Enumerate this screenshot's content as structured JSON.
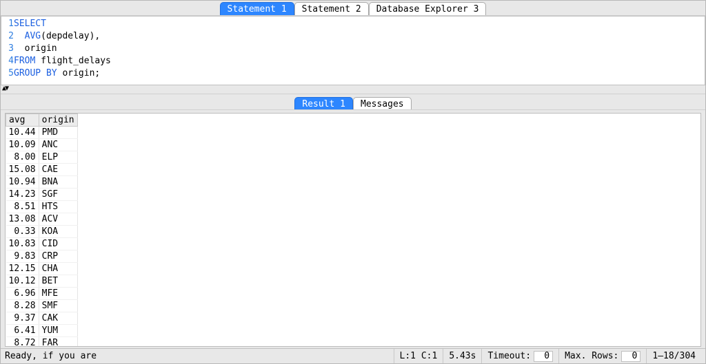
{
  "top_tabs": [
    {
      "label": "Statement 1",
      "active": true
    },
    {
      "label": "Statement 2",
      "active": false
    },
    {
      "label": "Database Explorer 3",
      "active": false
    }
  ],
  "editor": {
    "lines": [
      {
        "n": 1,
        "tokens": [
          {
            "t": "SELECT",
            "c": "kw"
          }
        ]
      },
      {
        "n": 2,
        "tokens": [
          {
            "t": "  ",
            "c": "plain"
          },
          {
            "t": "AVG",
            "c": "kw"
          },
          {
            "t": "(depdelay),",
            "c": "plain"
          }
        ]
      },
      {
        "n": 3,
        "tokens": [
          {
            "t": "  origin",
            "c": "plain"
          }
        ]
      },
      {
        "n": 4,
        "tokens": [
          {
            "t": "FROM",
            "c": "kw"
          },
          {
            "t": " flight_delays",
            "c": "plain"
          }
        ]
      },
      {
        "n": 5,
        "tokens": [
          {
            "t": "GROUP BY",
            "c": "kw"
          },
          {
            "t": " origin;",
            "c": "plain"
          }
        ]
      }
    ]
  },
  "mid_tabs": [
    {
      "label": "Result 1",
      "active": true
    },
    {
      "label": "Messages",
      "active": false
    }
  ],
  "result": {
    "columns": [
      "avg",
      "origin"
    ],
    "rows": [
      {
        "avg": "10.44",
        "origin": "PMD"
      },
      {
        "avg": "10.09",
        "origin": "ANC"
      },
      {
        "avg": "8.00",
        "origin": "ELP"
      },
      {
        "avg": "15.08",
        "origin": "CAE"
      },
      {
        "avg": "10.94",
        "origin": "BNA"
      },
      {
        "avg": "14.23",
        "origin": "SGF"
      },
      {
        "avg": "8.51",
        "origin": "HTS"
      },
      {
        "avg": "13.08",
        "origin": "ACV"
      },
      {
        "avg": "0.33",
        "origin": "KOA"
      },
      {
        "avg": "10.83",
        "origin": "CID"
      },
      {
        "avg": "9.83",
        "origin": "CRP"
      },
      {
        "avg": "12.15",
        "origin": "CHA"
      },
      {
        "avg": "10.12",
        "origin": "BET"
      },
      {
        "avg": "6.96",
        "origin": "MFE"
      },
      {
        "avg": "8.28",
        "origin": "SMF"
      },
      {
        "avg": "9.37",
        "origin": "CAK"
      },
      {
        "avg": "6.41",
        "origin": "YUM"
      },
      {
        "avg": "8.72",
        "origin": "FAR"
      }
    ]
  },
  "status": {
    "ready": "Ready, if you are",
    "cursor": "L:1 C:1",
    "elapsed": "5.43s",
    "timeout_label": "Timeout:",
    "timeout_value": "0",
    "maxrows_label": "Max. Rows:",
    "maxrows_value": "0",
    "range": "1–18/304"
  },
  "chart_data": {
    "type": "table",
    "title": "AVG(depdelay) by origin",
    "columns": [
      "avg",
      "origin"
    ],
    "rows": [
      [
        10.44,
        "PMD"
      ],
      [
        10.09,
        "ANC"
      ],
      [
        8.0,
        "ELP"
      ],
      [
        15.08,
        "CAE"
      ],
      [
        10.94,
        "BNA"
      ],
      [
        14.23,
        "SGF"
      ],
      [
        8.51,
        "HTS"
      ],
      [
        13.08,
        "ACV"
      ],
      [
        0.33,
        "KOA"
      ],
      [
        10.83,
        "CID"
      ],
      [
        9.83,
        "CRP"
      ],
      [
        12.15,
        "CHA"
      ],
      [
        10.12,
        "BET"
      ],
      [
        6.96,
        "MFE"
      ],
      [
        8.28,
        "SMF"
      ],
      [
        9.37,
        "CAK"
      ],
      [
        6.41,
        "YUM"
      ],
      [
        8.72,
        "FAR"
      ]
    ],
    "total_rows": 304,
    "visible_range": "1-18"
  }
}
